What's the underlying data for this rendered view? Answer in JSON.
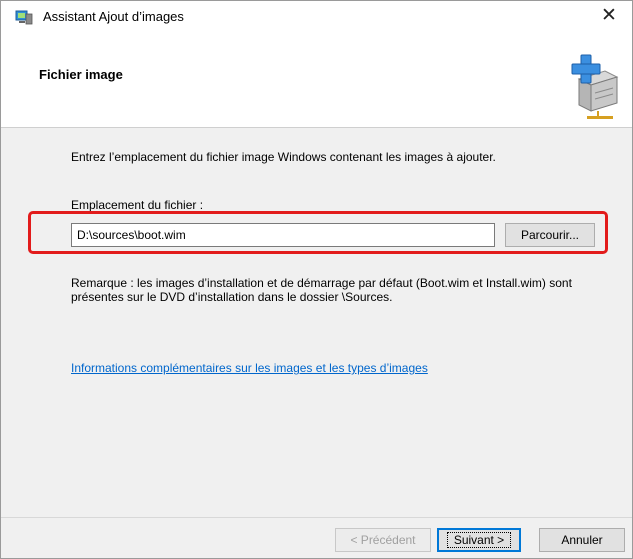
{
  "window": {
    "title": "Assistant Ajout d’images",
    "close_symbol": "✕",
    "icon": "server-computer-icon"
  },
  "header": {
    "title": "Fichier image",
    "icon": "add-image-server-icon"
  },
  "content": {
    "description": "Entrez l’emplacement du fichier image Windows contenant les images à ajouter.",
    "location_label": "Emplacement du fichier :",
    "location_value": "D:\\sources\\boot.wim",
    "browse_label": "Parcourir...",
    "note": "Remarque : les images d’installation et de démarrage par défaut (Boot.wim et Install.wim) sont présentes sur le DVD d’installation dans le dossier \\Sources.",
    "more_info_link": "Informations complémentaires sur les images et les types d’images"
  },
  "footer": {
    "prev_label": "< Précédent",
    "next_label": "Suivant >",
    "cancel_label": "Annuler"
  },
  "colors": {
    "highlight": "#e21b1b",
    "link": "#0066cc",
    "primary_border": "#0078d7"
  }
}
